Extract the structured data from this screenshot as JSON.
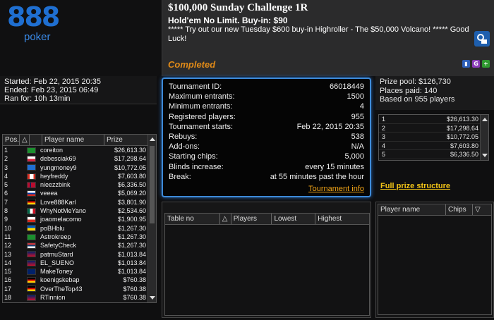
{
  "logo": {
    "number": "888",
    "brand": "poker"
  },
  "header": {
    "title": "$100,000 Sunday Challenge 1R",
    "game": "Hold'em No Limit. Buy-in: $90",
    "message": "***** Try out our new Tuesday $600 buy-in Highroller - The $50,000 Volcano! ***** Good Luck!",
    "status": "Completed"
  },
  "times": {
    "started": "Started: Feb 22, 2015 20:35",
    "ended": "Ended: Feb 23, 2015 06:49",
    "ran_for": "Ran for: 10h 13min"
  },
  "players_table": {
    "headers": {
      "pos": "Pos.",
      "sort_arrow": "△",
      "name": "Player name",
      "prize": "Prize"
    },
    "rows": [
      {
        "pos": "1",
        "flag": "brazil",
        "name": "coreiton",
        "prize": "$26,613.30"
      },
      {
        "pos": "2",
        "flag": "poland",
        "name": "debesciak69",
        "prize": "$17,298.64"
      },
      {
        "pos": "3",
        "flag": "888",
        "name": "yungmoney9",
        "prize": "$10,772.05"
      },
      {
        "pos": "4",
        "flag": "canada",
        "name": "heyfreddy",
        "prize": "$7,603.80"
      },
      {
        "pos": "5",
        "flag": "norway",
        "name": "nieezzbink",
        "prize": "$6,336.50"
      },
      {
        "pos": "6",
        "flag": "russia",
        "name": "veeea",
        "prize": "$5,069.20"
      },
      {
        "pos": "7",
        "flag": "germany",
        "name": "Love888Karl",
        "prize": "$3,801.90"
      },
      {
        "pos": "8",
        "flag": "mexico",
        "name": "WhyNotMeYano",
        "prize": "$2,534.60"
      },
      {
        "pos": "9",
        "flag": "chile",
        "name": "joaomelacomo",
        "prize": "$1,900.95"
      },
      {
        "pos": "10",
        "flag": "ukraine",
        "name": "poBHblu",
        "prize": "$1,267.30"
      },
      {
        "pos": "11",
        "flag": "brazil",
        "name": "Astrokreep",
        "prize": "$1,267.30"
      },
      {
        "pos": "12",
        "flag": "serbia",
        "name": "SafetyCheck",
        "prize": "$1,267.30"
      },
      {
        "pos": "13",
        "flag": "uk",
        "name": "patmuStard",
        "prize": "$1,013.84"
      },
      {
        "pos": "14",
        "flag": "uk",
        "name": "EL_SUENO",
        "prize": "$1,013.84"
      },
      {
        "pos": "15",
        "flag": "australia",
        "name": "MakeToney",
        "prize": "$1,013.84"
      },
      {
        "pos": "16",
        "flag": "germany",
        "name": "koenigskebap",
        "prize": "$760.38"
      },
      {
        "pos": "17",
        "flag": "germany",
        "name": "OverTheTop43",
        "prize": "$760.38"
      },
      {
        "pos": "18",
        "flag": "uk",
        "name": "RTinnion",
        "prize": "$760.38"
      }
    ]
  },
  "tournament": {
    "rows": [
      {
        "label": "Tournament ID:",
        "value": "66018449"
      },
      {
        "label": "Maximum entrants:",
        "value": "1500"
      },
      {
        "label": "Minimum entrants:",
        "value": "4"
      },
      {
        "label": "Registered players:",
        "value": "955"
      },
      {
        "label": "Tournament starts:",
        "value": "Feb 22, 2015 20:35"
      },
      {
        "label": "Rebuys:",
        "value": "538"
      },
      {
        "label": "Add-ons:",
        "value": "N/A"
      },
      {
        "label": "Starting chips:",
        "value": "5,000"
      },
      {
        "label": "Blinds increase:",
        "value": "every 15 minutes"
      },
      {
        "label": "Break:",
        "value": "at 55 minutes past the hour"
      }
    ],
    "info_link": "Tournament info"
  },
  "prize": {
    "pool": "Prize pool: $126,730",
    "places": "Places paid: 140",
    "based": "Based on 955 players",
    "list": [
      {
        "place": "1",
        "amount": "$26,613.30"
      },
      {
        "place": "2",
        "amount": "$17,298.64"
      },
      {
        "place": "3",
        "amount": "$10,772.05"
      },
      {
        "place": "4",
        "amount": "$7,603.80"
      },
      {
        "place": "5",
        "amount": "$6,336.50"
      }
    ],
    "full_link": "Full prize structure"
  },
  "tables_panel": {
    "headers": {
      "table_no": "Table no",
      "sort_arrow": "△",
      "players": "Players",
      "lowest": "Lowest",
      "highest": "Highest"
    }
  },
  "table_players": {
    "headers": {
      "player_name": "Player name",
      "chips": "Chips",
      "sort_arrow": "▽"
    }
  },
  "colors": {
    "accent_blue": "#3d8ad8",
    "status_orange": "#e08a18",
    "link_yellow": "#f2c417"
  }
}
